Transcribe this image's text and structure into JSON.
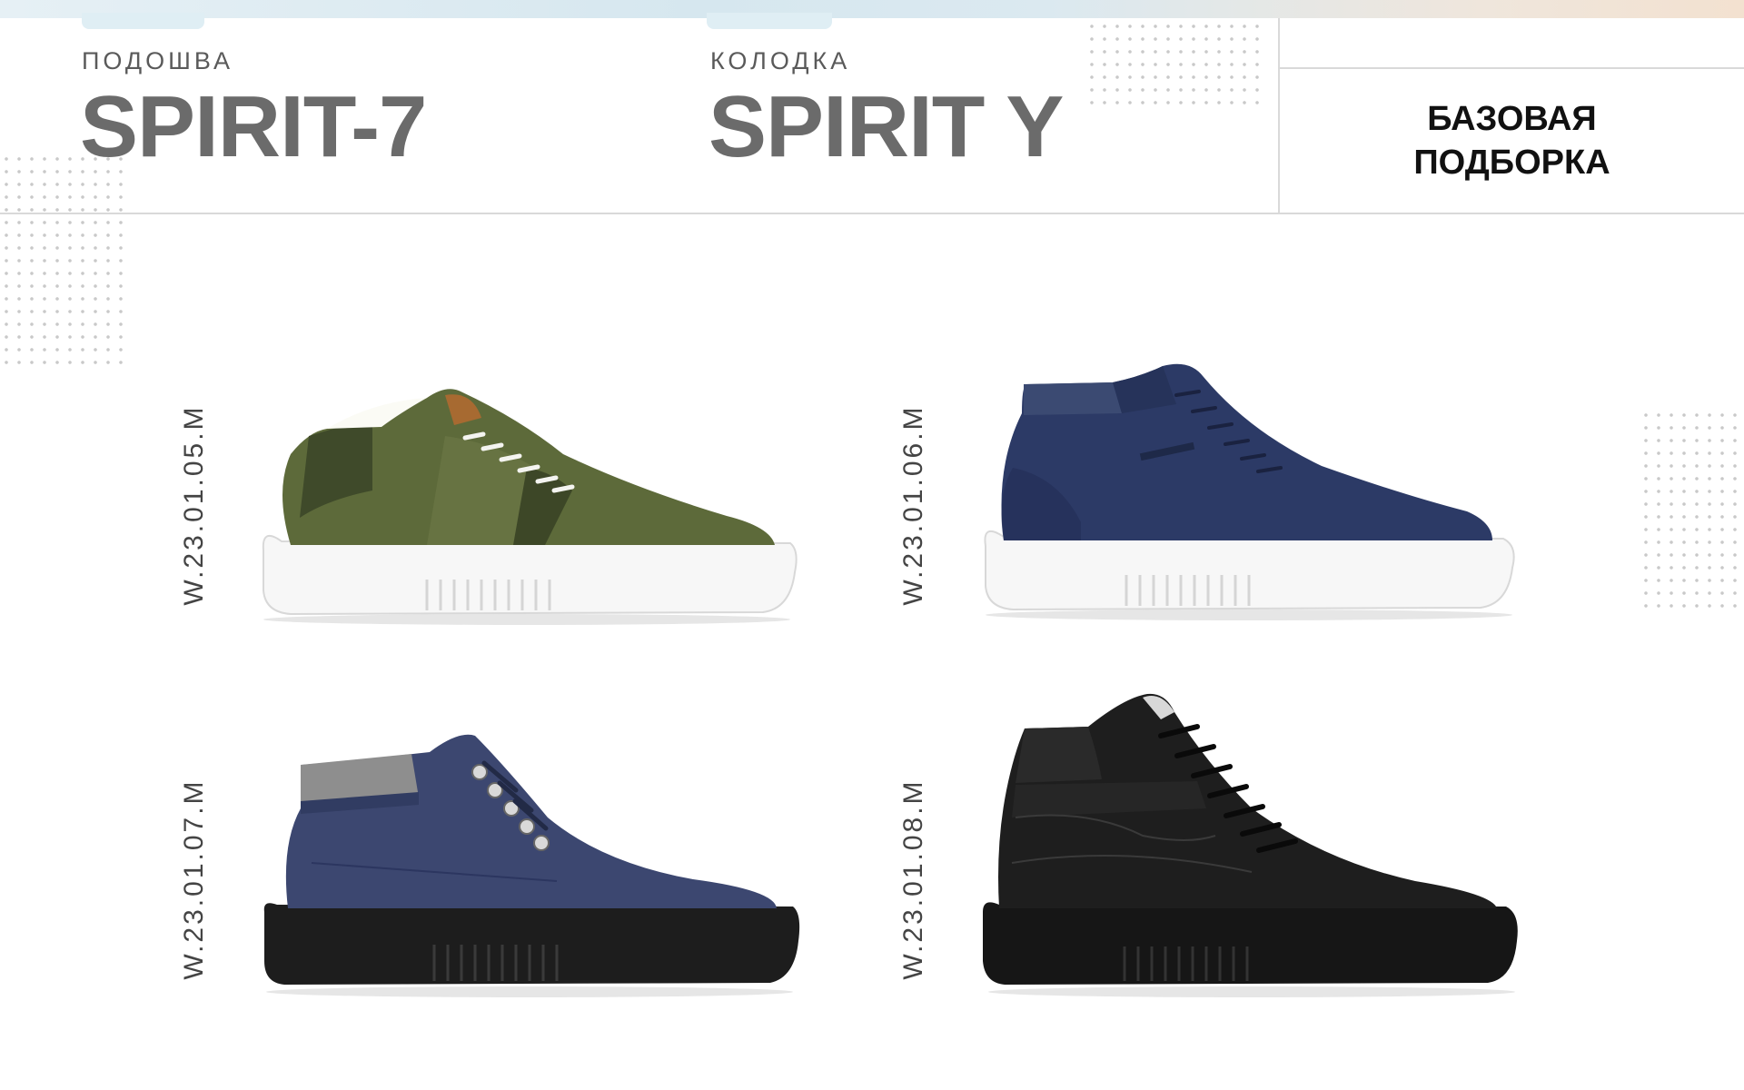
{
  "header": {
    "sole_label": "ПОДОШВА",
    "sole_name": "SPIRIT-7",
    "last_label": "КОЛОДКА",
    "last_name": "SPIRIT Y",
    "badge_line1": "БАЗОВАЯ",
    "badge_line2": "ПОДБОРКА"
  },
  "products": [
    {
      "sku": "W.23.01.05.M",
      "style": "low-top sneaker",
      "upper_color": "#5d6a3a",
      "sole_color": "#ffffff",
      "icon": "green-sneaker-image"
    },
    {
      "sku": "W.23.01.06.M",
      "style": "mid-top sneaker",
      "upper_color": "#2c3a66",
      "sole_color": "#ffffff",
      "icon": "navy-mid-sneaker-image"
    },
    {
      "sku": "W.23.01.07.M",
      "style": "chukka boot",
      "upper_color": "#3c4770",
      "sole_color": "#1a1a1a",
      "icon": "blue-chukka-image"
    },
    {
      "sku": "W.23.01.08.M",
      "style": "high-top leather sneaker",
      "upper_color": "#1c1c1c",
      "sole_color": "#141414",
      "icon": "black-hightop-image"
    }
  ]
}
